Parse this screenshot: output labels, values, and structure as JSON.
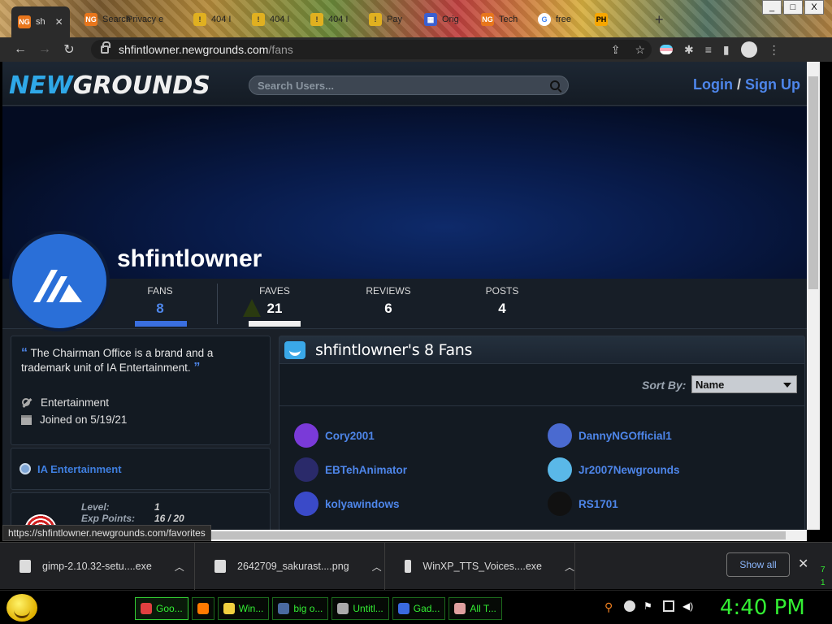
{
  "browser": {
    "tabs": [
      {
        "label": "sh",
        "icon": "ng",
        "active": true
      },
      {
        "label": "Search",
        "icon": "ng"
      },
      {
        "label": "Privacy e",
        "icon": "ng"
      },
      {
        "label": "404 I",
        "icon": "warn"
      },
      {
        "label": "404 I",
        "icon": "warn"
      },
      {
        "label": "404 I",
        "icon": "warn"
      },
      {
        "label": "Pay",
        "icon": "warn"
      },
      {
        "label": "Orig",
        "icon": "grid"
      },
      {
        "label": "Tech",
        "icon": "ng"
      },
      {
        "label": "free",
        "icon": "g"
      },
      {
        "label": "",
        "icon": "ph"
      }
    ],
    "new_tab": "+",
    "url_host": "shfintlowner.newgrounds.com",
    "url_path": "/fans",
    "window": {
      "minimize": "_",
      "maximize": "□",
      "close": "X"
    }
  },
  "site": {
    "logo_new": "NEW",
    "logo_grounds": "GROUNDS",
    "search_placeholder": "Search Users...",
    "login": "Login",
    "auth_sep": "/",
    "signup": "Sign Up"
  },
  "profile": {
    "username": "shfintlowner",
    "stats": [
      {
        "label": "FANS",
        "value": "8",
        "active": true
      },
      {
        "label": "FAVES",
        "value": "21"
      },
      {
        "label": "REVIEWS",
        "value": "6"
      },
      {
        "label": "POSTS",
        "value": "4"
      }
    ],
    "bio": "The Chairman Office is a brand and a trademark unit of IA Entertainment.",
    "quote_open": "“",
    "quote_close": "”",
    "occupation": "Entertainment",
    "joined": "Joined on 5/19/21",
    "affiliation": "IA Entertainment",
    "level_label": "Level:",
    "level_value": "1",
    "exp_label": "Exp Points:",
    "exp_value": "16 / 20"
  },
  "fans_panel": {
    "title": "shfintlowner's 8 Fans",
    "sort_label": "Sort By:",
    "sort_value": "Name",
    "fans": [
      {
        "name": "Cory2001",
        "color": "#7a3ad8"
      },
      {
        "name": "DannyNGOfficial1",
        "color": "#4a6ad0"
      },
      {
        "name": "EBTehAnimator",
        "color": "#2a2a6a"
      },
      {
        "name": "Jr2007Newgrounds",
        "color": "#5ab8e8"
      },
      {
        "name": "kolyawindows",
        "color": "#3a4ac8"
      },
      {
        "name": "RS1701",
        "color": "#111111"
      }
    ]
  },
  "status_bar_url": "https://shfintlowner.newgrounds.com/favorites",
  "downloads": {
    "items": [
      {
        "name": "gimp-2.10.32-setu....exe"
      },
      {
        "name": "2642709_sakurast....png"
      },
      {
        "name": "WinXP_TTS_Voices....exe"
      }
    ],
    "show_all": "Show all",
    "close": "✕"
  },
  "taskbar": {
    "buttons": [
      {
        "label": "Goo...",
        "color": "#e04040"
      },
      {
        "label": "",
        "color": "#ff7a00"
      },
      {
        "label": "Win...",
        "color": "#f0d040"
      },
      {
        "label": "big o...",
        "color": "#4a6aa0"
      },
      {
        "label": "Untitl...",
        "color": "#aaaaaa"
      },
      {
        "label": "Gad...",
        "color": "#3a6ae0"
      },
      {
        "label": "All T...",
        "color": "#e0a0a0"
      }
    ],
    "clock": "4:40 PM",
    "side_digits": [
      "7",
      "1"
    ]
  },
  "colors": {
    "accent": "#4e86ea",
    "taskbar_green": "#33ee33"
  }
}
